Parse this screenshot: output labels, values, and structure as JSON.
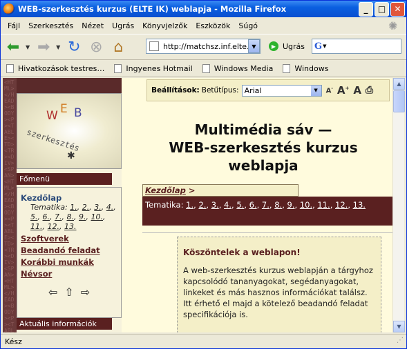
{
  "window": {
    "title": "WEB-szerkesztés kurzus (ELTE IK) weblapja - Mozilla Firefox"
  },
  "menu": [
    "Fájl",
    "Szerkesztés",
    "Nézet",
    "Ugrás",
    "Könyvjelzők",
    "Eszközök",
    "Súgó"
  ],
  "toolbar": {
    "url": "http://matchsz.inf.elte.hu/",
    "go_label": "Ugrás",
    "search_logo": "G"
  },
  "bookmarks": [
    "Hivatkozások testres…",
    "Ingyenes Hotmail",
    "Windows Media",
    "Windows"
  ],
  "settings": {
    "label": "Beállítások:",
    "font_label": "Betűtípus:",
    "font_value": "Arial"
  },
  "logo": {
    "w": "W",
    "e": "E",
    "b": "B",
    "sub": "szerkesztés"
  },
  "left": {
    "menu_head": "Főmenü",
    "home": "Kezdőlap",
    "tematika_label": "Tematika:",
    "tematika_nums": [
      "1.",
      "2.",
      "3.",
      "4.",
      "5.",
      "6.",
      "7.",
      "8.",
      "9.",
      "10.",
      "11.",
      "12.",
      "13."
    ],
    "items": [
      "Szoftverek",
      "Beadandó feladat",
      "Korábbi munkák",
      "Névsor"
    ],
    "info_head": "Aktuális információk"
  },
  "main": {
    "title_line1": "Multimédia sáv —",
    "title_line2": "WEB-szerkesztés kurzus",
    "title_line3": "weblapja",
    "crumb": "Kezdőlap",
    "crumb_sep": ">",
    "tematika_label": "Tematika:",
    "welcome_title": "Köszöntelek a weblapon!",
    "welcome_text": "A web-szerkesztés kurzus weblapján a tárgyhoz kapcsolódó tananyagokat, segédanyagokat, linkeket és más hasznos információkat találsz. Itt érhető el majd a kötelező beadandó feladat specifikációja is."
  },
  "status": {
    "text": "Kész"
  }
}
